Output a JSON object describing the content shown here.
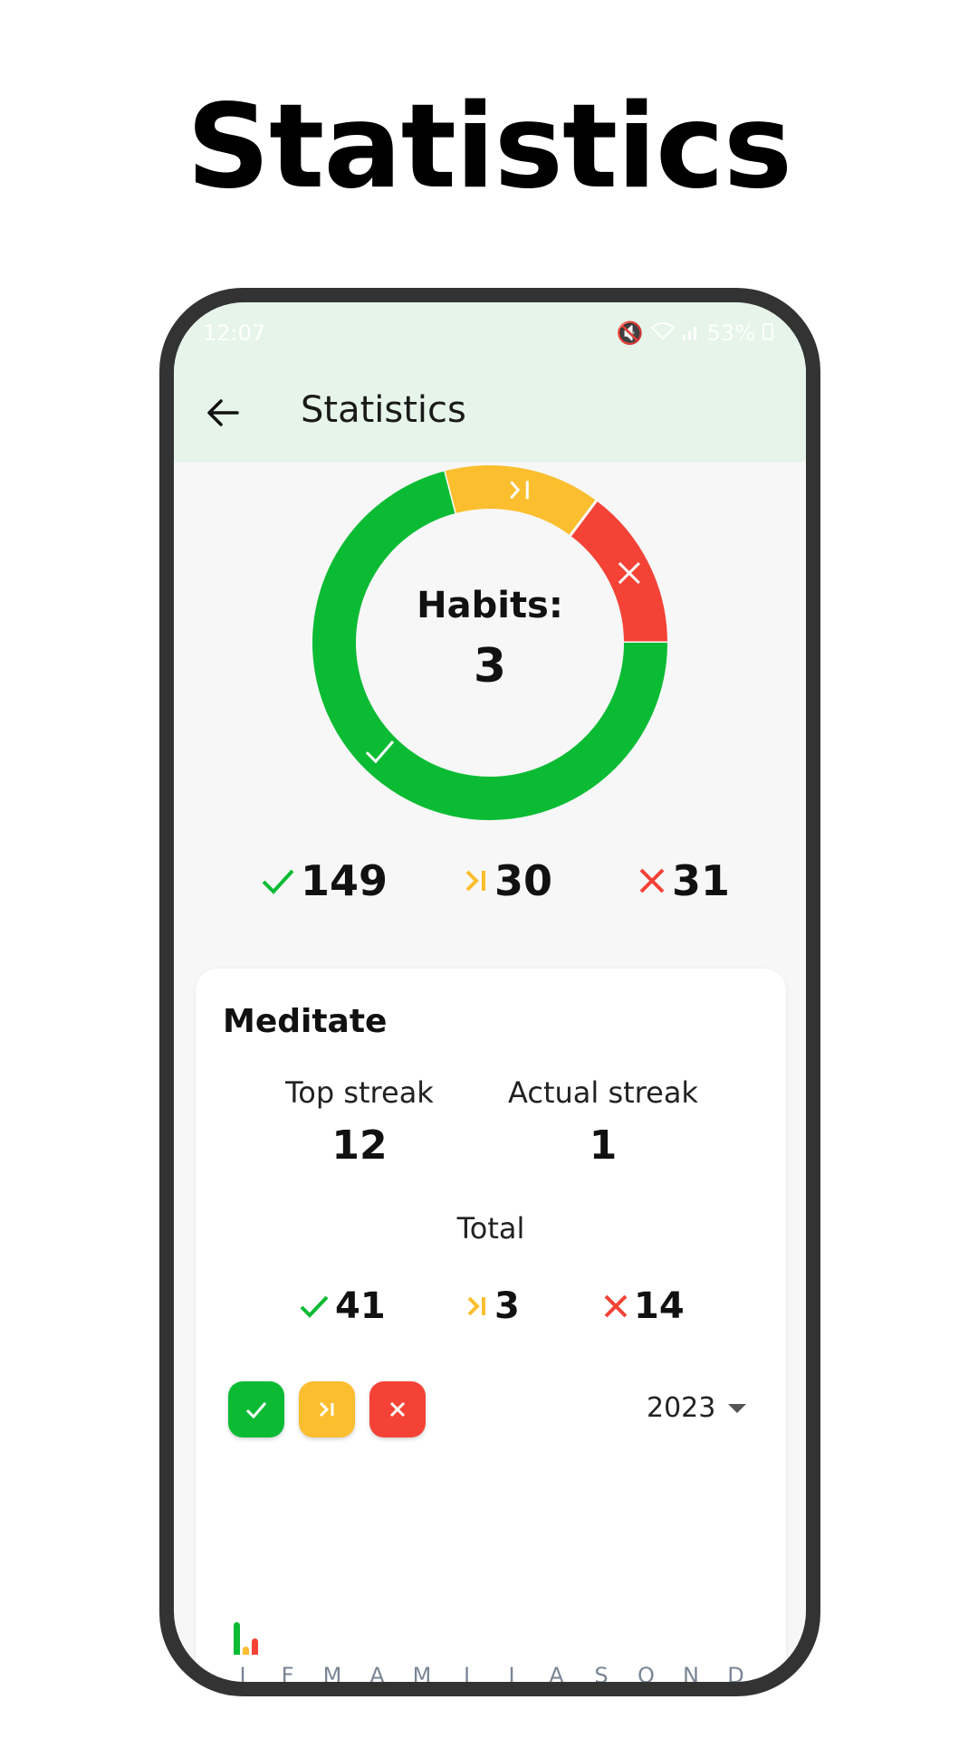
{
  "headline": "Statistics",
  "status_bar": {
    "time": "12:07",
    "battery": "53%"
  },
  "appbar": {
    "title": "Statistics"
  },
  "colors": {
    "done": "#0cbb34",
    "skipped": "#fbbe2e",
    "failed": "#f44336",
    "appbar_bg": "#e6f4e9"
  },
  "donut": {
    "label": "Habits:",
    "count": "3"
  },
  "summary": {
    "done": "149",
    "skipped": "30",
    "failed": "31"
  },
  "habit_card": {
    "title": "Meditate",
    "top_streak_label": "Top streak",
    "top_streak_value": "12",
    "actual_streak_label": "Actual streak",
    "actual_streak_value": "1",
    "total_label": "Total",
    "totals": {
      "done": "41",
      "skipped": "3",
      "failed": "14"
    },
    "year": "2023"
  },
  "chart_data": {
    "type": "bar",
    "categories": [
      "J",
      "F",
      "M",
      "A",
      "M",
      "J",
      "J",
      "A",
      "S",
      "O",
      "N",
      "D"
    ],
    "series": [
      {
        "values": [
          4,
          0,
          0,
          0,
          0,
          0,
          0,
          0,
          0,
          0,
          0,
          0
        ],
        "color": "#0cbb34"
      },
      {
        "values": [
          1,
          0,
          0,
          0,
          0,
          0,
          0,
          0,
          0,
          0,
          0,
          0
        ],
        "color": "#fbbe2e"
      },
      {
        "values": [
          2,
          0,
          0,
          0,
          0,
          0,
          0,
          0,
          0,
          0,
          0,
          0
        ],
        "color": "#f44336"
      }
    ]
  }
}
